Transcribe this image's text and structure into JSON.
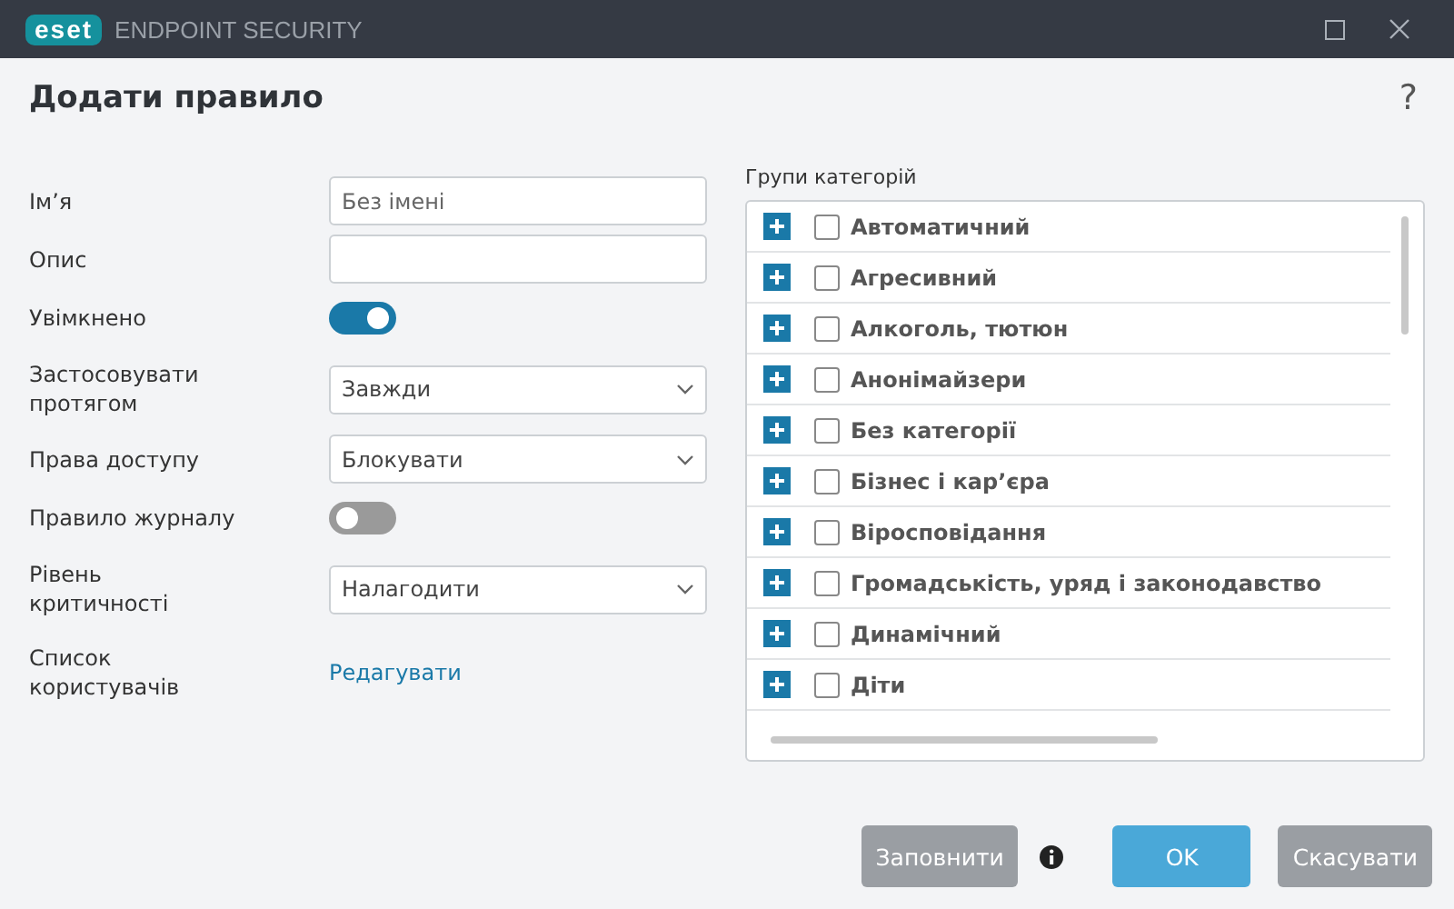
{
  "window": {
    "logo": "eset",
    "title": "ENDPOINT SECURITY"
  },
  "dialog": {
    "title": "Додати правило",
    "help": "?"
  },
  "form": [
    {
      "kind": "text",
      "label": "Ім’я",
      "placeholder": "Без імені"
    },
    {
      "kind": "text",
      "label": "Опис"
    },
    {
      "kind": "toggle",
      "label": "Увімкнено",
      "on": true
    },
    {
      "kind": "select",
      "label": "Застосовувати протягом",
      "value": "Завжди"
    },
    {
      "kind": "select",
      "label": "Права доступу",
      "value": "Блокувати"
    },
    {
      "kind": "toggle",
      "label": "Правило журналу",
      "on": false
    },
    {
      "kind": "select",
      "label": "Рівень критичності",
      "value": "Налагодити"
    },
    {
      "kind": "link",
      "label": "Список користувачів",
      "value": "Редагувати"
    }
  ],
  "categories": {
    "label": "Групи категорій",
    "items": [
      {
        "name": "Автоматичний",
        "checked": false
      },
      {
        "name": "Агресивний",
        "checked": false
      },
      {
        "name": "Алкоголь, тютюн",
        "checked": false
      },
      {
        "name": "Анонімайзери",
        "checked": false
      },
      {
        "name": "Без категорії",
        "checked": false
      },
      {
        "name": "Бізнес і кар’єра",
        "checked": false
      },
      {
        "name": "Віросповідання",
        "checked": false
      },
      {
        "name": "Громадськість, уряд і законодавство",
        "checked": false
      },
      {
        "name": "Динамічний",
        "checked": false
      },
      {
        "name": "Діти",
        "checked": false
      }
    ]
  },
  "buttons": [
    {
      "label": "Заповнити",
      "kind": "secondary",
      "info": true
    },
    {
      "label": "OK",
      "kind": "primary"
    },
    {
      "label": "Скасувати",
      "kind": "secondary"
    }
  ]
}
